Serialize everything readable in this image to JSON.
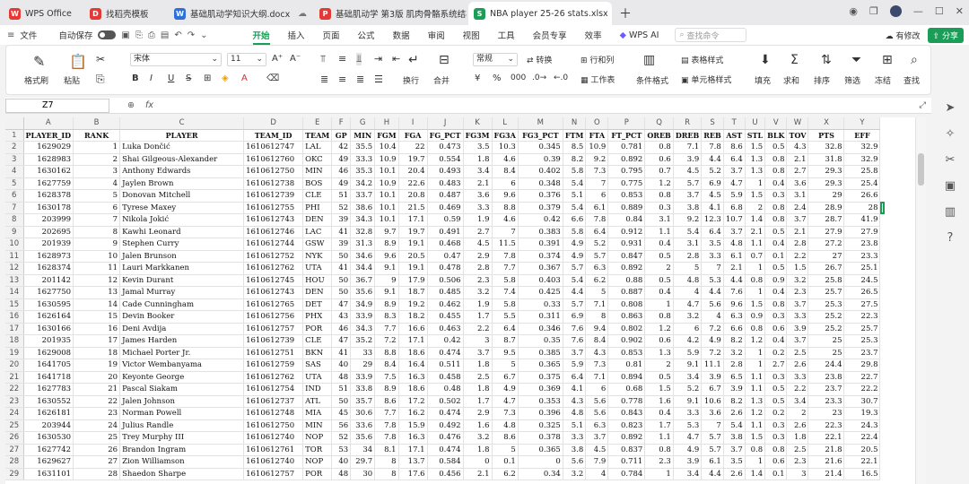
{
  "tabs": [
    {
      "label": "WPS Office",
      "icon": "W",
      "color": "#e53935"
    },
    {
      "label": "找稻壳模板",
      "icon": "D",
      "color": "#e53935"
    },
    {
      "label": "基础肌动学知识大纲.docx",
      "icon": "W",
      "color": "#2f6fd8"
    },
    {
      "label": "基础肌动学 第3版 肌肉骨骼系统结构",
      "icon": "P",
      "color": "#e53935"
    },
    {
      "label": "NBA player 25-26 stats.xlsx",
      "icon": "S",
      "color": "#1a9e57"
    }
  ],
  "menu": {
    "file": "文件",
    "autosave": "自动保存",
    "items": [
      "开始",
      "插入",
      "页面",
      "公式",
      "数据",
      "审阅",
      "视图",
      "工具",
      "会员专享",
      "效率"
    ],
    "active": "开始",
    "wps_ai": "WPS AI",
    "search_placeholder": "查找命令",
    "modified": "有修改",
    "share": "分享"
  },
  "ribbon": {
    "format_painter": "格式刷",
    "paste": "粘贴",
    "font_name": "宋体",
    "font_size": "11",
    "wrap": "换行",
    "merge": "合并",
    "number_format": "常规",
    "convert": "转换",
    "row_col": "行和列",
    "worksheet": "工作表",
    "cond_format": "条件格式",
    "table_style": "表格样式",
    "cell_style": "单元格样式",
    "fill": "填充",
    "sum": "求和",
    "sort": "排序",
    "filter": "筛选",
    "freeze": "冻结",
    "find": "查找"
  },
  "formula": {
    "cell_ref": "Z7",
    "fx": "fx",
    "value": ""
  },
  "columns": [
    "A",
    "B",
    "C",
    "D",
    "E",
    "F",
    "G",
    "H",
    "I",
    "J",
    "K",
    "L",
    "M",
    "N",
    "O",
    "P",
    "Q",
    "R",
    "S",
    "T",
    "U",
    "V",
    "W",
    "X",
    "Y"
  ],
  "headers": [
    "PLAYER_ID",
    "RANK",
    "PLAYER",
    "TEAM_ID",
    "TEAM",
    "GP",
    "MIN",
    "FGM",
    "FGA",
    "FG_PCT",
    "FG3M",
    "FG3A",
    "FG3_PCT",
    "FTM",
    "FTA",
    "FT_PCT",
    "OREB",
    "DREB",
    "REB",
    "AST",
    "STL",
    "BLK",
    "TOV",
    "PTS",
    "EFF"
  ],
  "rows": [
    [
      "1629029",
      "1",
      "Luka Dončić",
      "1610612747",
      "LAL",
      "42",
      "35.5",
      "10.4",
      "22",
      "0.473",
      "3.5",
      "10.3",
      "0.345",
      "8.5",
      "10.9",
      "0.781",
      "0.8",
      "7.1",
      "7.8",
      "8.6",
      "1.5",
      "0.5",
      "4.3",
      "32.8",
      "32.9"
    ],
    [
      "1628983",
      "2",
      "Shai Gilgeous-Alexander",
      "1610612760",
      "OKC",
      "49",
      "33.3",
      "10.9",
      "19.7",
      "0.554",
      "1.8",
      "4.6",
      "0.39",
      "8.2",
      "9.2",
      "0.892",
      "0.6",
      "3.9",
      "4.4",
      "6.4",
      "1.3",
      "0.8",
      "2.1",
      "31.8",
      "32.9"
    ],
    [
      "1630162",
      "3",
      "Anthony Edwards",
      "1610612750",
      "MIN",
      "46",
      "35.3",
      "10.1",
      "20.4",
      "0.493",
      "3.4",
      "8.4",
      "0.402",
      "5.8",
      "7.3",
      "0.795",
      "0.7",
      "4.5",
      "5.2",
      "3.7",
      "1.3",
      "0.8",
      "2.7",
      "29.3",
      "25.8"
    ],
    [
      "1627759",
      "4",
      "Jaylen Brown",
      "1610612738",
      "BOS",
      "49",
      "34.2",
      "10.9",
      "22.6",
      "0.483",
      "2.1",
      "6",
      "0.348",
      "5.4",
      "7",
      "0.775",
      "1.2",
      "5.7",
      "6.9",
      "4.7",
      "1",
      "0.4",
      "3.6",
      "29.3",
      "25.4"
    ],
    [
      "1628378",
      "5",
      "Donovan Mitchell",
      "1610612739",
      "CLE",
      "51",
      "33.7",
      "10.1",
      "20.8",
      "0.487",
      "3.6",
      "9.6",
      "0.376",
      "5.1",
      "6",
      "0.853",
      "0.8",
      "3.7",
      "4.5",
      "5.9",
      "1.5",
      "0.3",
      "3.1",
      "29",
      "26.6"
    ],
    [
      "1630178",
      "6",
      "Tyrese Maxey",
      "1610612755",
      "PHI",
      "52",
      "38.6",
      "10.1",
      "21.5",
      "0.469",
      "3.3",
      "8.8",
      "0.379",
      "5.4",
      "6.1",
      "0.889",
      "0.3",
      "3.8",
      "4.1",
      "6.8",
      "2",
      "0.8",
      "2.4",
      "28.9",
      "28"
    ],
    [
      "203999",
      "7",
      "Nikola Jokić",
      "1610612743",
      "DEN",
      "39",
      "34.3",
      "10.1",
      "17.1",
      "0.59",
      "1.9",
      "4.6",
      "0.42",
      "6.6",
      "7.8",
      "0.84",
      "3.1",
      "9.2",
      "12.3",
      "10.7",
      "1.4",
      "0.8",
      "3.7",
      "28.7",
      "41.9"
    ],
    [
      "202695",
      "8",
      "Kawhi Leonard",
      "1610612746",
      "LAC",
      "41",
      "32.8",
      "9.7",
      "19.7",
      "0.491",
      "2.7",
      "7",
      "0.383",
      "5.8",
      "6.4",
      "0.912",
      "1.1",
      "5.4",
      "6.4",
      "3.7",
      "2.1",
      "0.5",
      "2.1",
      "27.9",
      "27.9"
    ],
    [
      "201939",
      "9",
      "Stephen Curry",
      "1610612744",
      "GSW",
      "39",
      "31.3",
      "8.9",
      "19.1",
      "0.468",
      "4.5",
      "11.5",
      "0.391",
      "4.9",
      "5.2",
      "0.931",
      "0.4",
      "3.1",
      "3.5",
      "4.8",
      "1.1",
      "0.4",
      "2.8",
      "27.2",
      "23.8"
    ],
    [
      "1628973",
      "10",
      "Jalen Brunson",
      "1610612752",
      "NYK",
      "50",
      "34.6",
      "9.6",
      "20.5",
      "0.47",
      "2.9",
      "7.8",
      "0.374",
      "4.9",
      "5.7",
      "0.847",
      "0.5",
      "2.8",
      "3.3",
      "6.1",
      "0.7",
      "0.1",
      "2.2",
      "27",
      "23.3"
    ],
    [
      "1628374",
      "11",
      "Lauri Markkanen",
      "1610612762",
      "UTA",
      "41",
      "34.4",
      "9.1",
      "19.1",
      "0.478",
      "2.8",
      "7.7",
      "0.367",
      "5.7",
      "6.3",
      "0.892",
      "2",
      "5",
      "7",
      "2.1",
      "1",
      "0.5",
      "1.5",
      "26.7",
      "25.1"
    ],
    [
      "201142",
      "12",
      "Kevin Durant",
      "1610612745",
      "HOU",
      "50",
      "36.7",
      "9",
      "17.9",
      "0.506",
      "2.3",
      "5.8",
      "0.403",
      "5.4",
      "6.2",
      "0.88",
      "0.5",
      "4.8",
      "5.3",
      "4.4",
      "0.8",
      "0.9",
      "3.2",
      "25.8",
      "24.5"
    ],
    [
      "1627750",
      "13",
      "Jamal Murray",
      "1610612743",
      "DEN",
      "50",
      "35.6",
      "9.1",
      "18.7",
      "0.485",
      "3.2",
      "7.4",
      "0.425",
      "4.4",
      "5",
      "0.887",
      "0.4",
      "4",
      "4.4",
      "7.6",
      "1",
      "0.4",
      "2.3",
      "25.7",
      "26.5"
    ],
    [
      "1630595",
      "14",
      "Cade Cunningham",
      "1610612765",
      "DET",
      "47",
      "34.9",
      "8.9",
      "19.2",
      "0.462",
      "1.9",
      "5.8",
      "0.33",
      "5.7",
      "7.1",
      "0.808",
      "1",
      "4.7",
      "5.6",
      "9.6",
      "1.5",
      "0.8",
      "3.7",
      "25.3",
      "27.5"
    ],
    [
      "1626164",
      "15",
      "Devin Booker",
      "1610612756",
      "PHX",
      "43",
      "33.9",
      "8.3",
      "18.2",
      "0.455",
      "1.7",
      "5.5",
      "0.311",
      "6.9",
      "8",
      "0.863",
      "0.8",
      "3.2",
      "4",
      "6.3",
      "0.9",
      "0.3",
      "3.3",
      "25.2",
      "22.3"
    ],
    [
      "1630166",
      "16",
      "Deni Avdija",
      "1610612757",
      "POR",
      "46",
      "34.3",
      "7.7",
      "16.6",
      "0.463",
      "2.2",
      "6.4",
      "0.346",
      "7.6",
      "9.4",
      "0.802",
      "1.2",
      "6",
      "7.2",
      "6.6",
      "0.8",
      "0.6",
      "3.9",
      "25.2",
      "25.7"
    ],
    [
      "201935",
      "17",
      "James Harden",
      "1610612739",
      "CLE",
      "47",
      "35.2",
      "7.2",
      "17.1",
      "0.42",
      "3",
      "8.7",
      "0.35",
      "7.6",
      "8.4",
      "0.902",
      "0.6",
      "4.2",
      "4.9",
      "8.2",
      "1.2",
      "0.4",
      "3.7",
      "25",
      "25.3"
    ],
    [
      "1629008",
      "18",
      "Michael Porter Jr.",
      "1610612751",
      "BKN",
      "41",
      "33",
      "8.8",
      "18.6",
      "0.474",
      "3.7",
      "9.5",
      "0.385",
      "3.7",
      "4.3",
      "0.853",
      "1.3",
      "5.9",
      "7.2",
      "3.2",
      "1",
      "0.2",
      "2.5",
      "25",
      "23.7"
    ],
    [
      "1641705",
      "19",
      "Victor Wembanyama",
      "1610612759",
      "SAS",
      "40",
      "29",
      "8.4",
      "16.4",
      "0.511",
      "1.8",
      "5",
      "0.365",
      "5.9",
      "7.3",
      "0.81",
      "2",
      "9.1",
      "11.1",
      "2.8",
      "1",
      "2.7",
      "2.6",
      "24.4",
      "29.8"
    ],
    [
      "1641718",
      "20",
      "Keyonte George",
      "1610612762",
      "UTA",
      "48",
      "33.9",
      "7.5",
      "16.3",
      "0.458",
      "2.5",
      "6.7",
      "0.375",
      "6.4",
      "7.1",
      "0.894",
      "0.5",
      "3.4",
      "3.9",
      "6.5",
      "1.1",
      "0.3",
      "3.3",
      "23.8",
      "22.7"
    ],
    [
      "1627783",
      "21",
      "Pascal Siakam",
      "1610612754",
      "IND",
      "51",
      "33.8",
      "8.9",
      "18.6",
      "0.48",
      "1.8",
      "4.9",
      "0.369",
      "4.1",
      "6",
      "0.68",
      "1.5",
      "5.2",
      "6.7",
      "3.9",
      "1.1",
      "0.5",
      "2.2",
      "23.7",
      "22.2"
    ],
    [
      "1630552",
      "22",
      "Jalen Johnson",
      "1610612737",
      "ATL",
      "50",
      "35.7",
      "8.6",
      "17.2",
      "0.502",
      "1.7",
      "4.7",
      "0.353",
      "4.3",
      "5.6",
      "0.778",
      "1.6",
      "9.1",
      "10.6",
      "8.2",
      "1.3",
      "0.5",
      "3.4",
      "23.3",
      "30.7"
    ],
    [
      "1626181",
      "23",
      "Norman Powell",
      "1610612748",
      "MIA",
      "45",
      "30.6",
      "7.7",
      "16.2",
      "0.474",
      "2.9",
      "7.3",
      "0.396",
      "4.8",
      "5.6",
      "0.843",
      "0.4",
      "3.3",
      "3.6",
      "2.6",
      "1.2",
      "0.2",
      "2",
      "23",
      "19.3"
    ],
    [
      "203944",
      "24",
      "Julius Randle",
      "1610612750",
      "MIN",
      "56",
      "33.6",
      "7.8",
      "15.9",
      "0.492",
      "1.6",
      "4.8",
      "0.325",
      "5.1",
      "6.3",
      "0.823",
      "1.7",
      "5.3",
      "7",
      "5.4",
      "1.1",
      "0.3",
      "2.6",
      "22.3",
      "24.3"
    ],
    [
      "1630530",
      "25",
      "Trey Murphy III",
      "1610612740",
      "NOP",
      "52",
      "35.6",
      "7.8",
      "16.3",
      "0.476",
      "3.2",
      "8.6",
      "0.378",
      "3.3",
      "3.7",
      "0.892",
      "1.1",
      "4.7",
      "5.7",
      "3.8",
      "1.5",
      "0.3",
      "1.8",
      "22.1",
      "22.4"
    ],
    [
      "1627742",
      "26",
      "Brandon Ingram",
      "1610612761",
      "TOR",
      "53",
      "34",
      "8.1",
      "17.1",
      "0.474",
      "1.8",
      "5",
      "0.365",
      "3.8",
      "4.5",
      "0.837",
      "0.8",
      "4.9",
      "5.7",
      "3.7",
      "0.8",
      "0.8",
      "2.5",
      "21.8",
      "20.5"
    ],
    [
      "1629627",
      "27",
      "Zion Williamson",
      "1610612740",
      "NOP",
      "40",
      "29.7",
      "8",
      "13.7",
      "0.584",
      "0",
      "0.1",
      "0",
      "5.6",
      "7.9",
      "0.711",
      "2.3",
      "3.9",
      "6.1",
      "3.5",
      "1",
      "0.6",
      "2.3",
      "21.6",
      "22.1"
    ],
    [
      "1631101",
      "28",
      "Shaedon Sharpe",
      "1610612757",
      "POR",
      "48",
      "30",
      "8",
      "17.6",
      "0.456",
      "2.1",
      "6.2",
      "0.34",
      "3.2",
      "4",
      "0.784",
      "1",
      "3.4",
      "4.4",
      "2.6",
      "1.4",
      "0.1",
      "3",
      "21.4",
      "16.5"
    ]
  ]
}
